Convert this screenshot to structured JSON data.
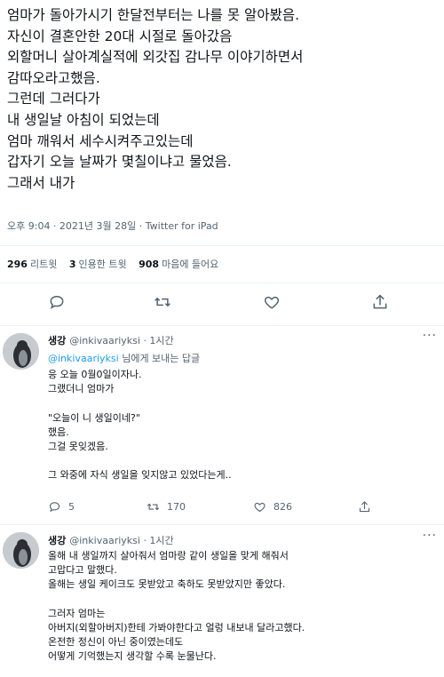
{
  "main_tweet": {
    "lines": [
      "엄마가 돌아가시기 한달전부터는 나를 못 알아봤음.",
      "자신이 결혼안한 20대 시절로 돌아갔음",
      "외할머니 살아계실적에 외갓집  감나무 이야기하면서",
      "감따오라고했음.",
      "그런데 그러다가",
      "내 생일날 아침이 되었는데",
      "엄마 깨워서 세수시켜주고있는데",
      "갑자기 오늘 날짜가 몇칠이냐고 물었음.",
      "그래서 내가"
    ],
    "meta": "오후 9:04 · 2021년 3월 28일 · Twitter for iPad",
    "stats": [
      {
        "count": "296",
        "label": "리트윗"
      },
      {
        "count": "3",
        "label": "인용한 트윗"
      },
      {
        "count": "908",
        "label": "마음에 들어요"
      }
    ],
    "actions": [
      "reply-icon",
      "retweet-icon",
      "like-icon",
      "share-icon"
    ]
  },
  "replies": [
    {
      "name": "생강",
      "handle": "@inkivaariyksi · 1시간",
      "replying_to": "@inkivaariyksi",
      "replying_suffix": "님에게 보내는 답글",
      "lines": [
        "응 오늘 0월0일이자나.",
        "그랬더니 엄마가",
        "",
        "\"오늘이 니 생일이네?\"",
        "했음.",
        "그걸 못잊겠음.",
        "",
        "그 와중에 자식 생일을 잊지않고 있었다는게..",
        ""
      ],
      "reply_count": "5",
      "retweet_count": "170",
      "like_count": "826",
      "more": "···"
    },
    {
      "name": "생강",
      "handle": "@inkivaariyksi · 1시간",
      "lines": [
        "올해 내 생일까지 살아줘서 엄마랑 같이 생일을 맞게 해줘서",
        "고맙다고 말했다.",
        "올해는 생일 케이크도 못받았고 축하도 못받았지만 좋았다.",
        "",
        "그러자 엄마는",
        "아버지(외할아버지)한테 가봐야한다고  얼렁 내보내 달라고했다.",
        "온전한 정신이 아닌 중이였는데도",
        "어떻게 기억했는지 생각할 수록 눈물난다."
      ],
      "more": "···"
    }
  ],
  "colors": {
    "text": "#0f1419",
    "secondary": "#536471",
    "link": "#1d9bf0",
    "divider": "#eff3f4"
  }
}
